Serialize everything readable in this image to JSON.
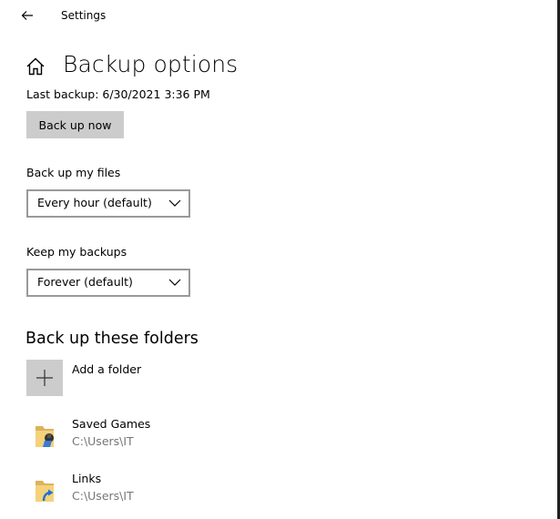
{
  "window": {
    "title": "Settings",
    "accent_color": "#0078d7"
  },
  "titlebar": {
    "back_icon": "back-arrow-icon"
  },
  "page": {
    "home_icon": "home-icon",
    "title": "Backup options",
    "last_backup": "Last backup: 6/30/2021 3:36 PM",
    "backup_now_label": "Back up now"
  },
  "backup_frequency": {
    "label": "Back up my files",
    "selected": "Every hour (default)"
  },
  "retention": {
    "label": "Keep my backups",
    "selected": "Forever (default)"
  },
  "folders": {
    "section_title": "Back up these folders",
    "add_label": "Add a folder",
    "items": [
      {
        "name": "Saved Games",
        "path": "C:\\Users\\IT",
        "icon": "saved-games-folder-icon"
      },
      {
        "name": "Links",
        "path": "C:\\Users\\IT",
        "icon": "links-folder-icon"
      }
    ]
  }
}
